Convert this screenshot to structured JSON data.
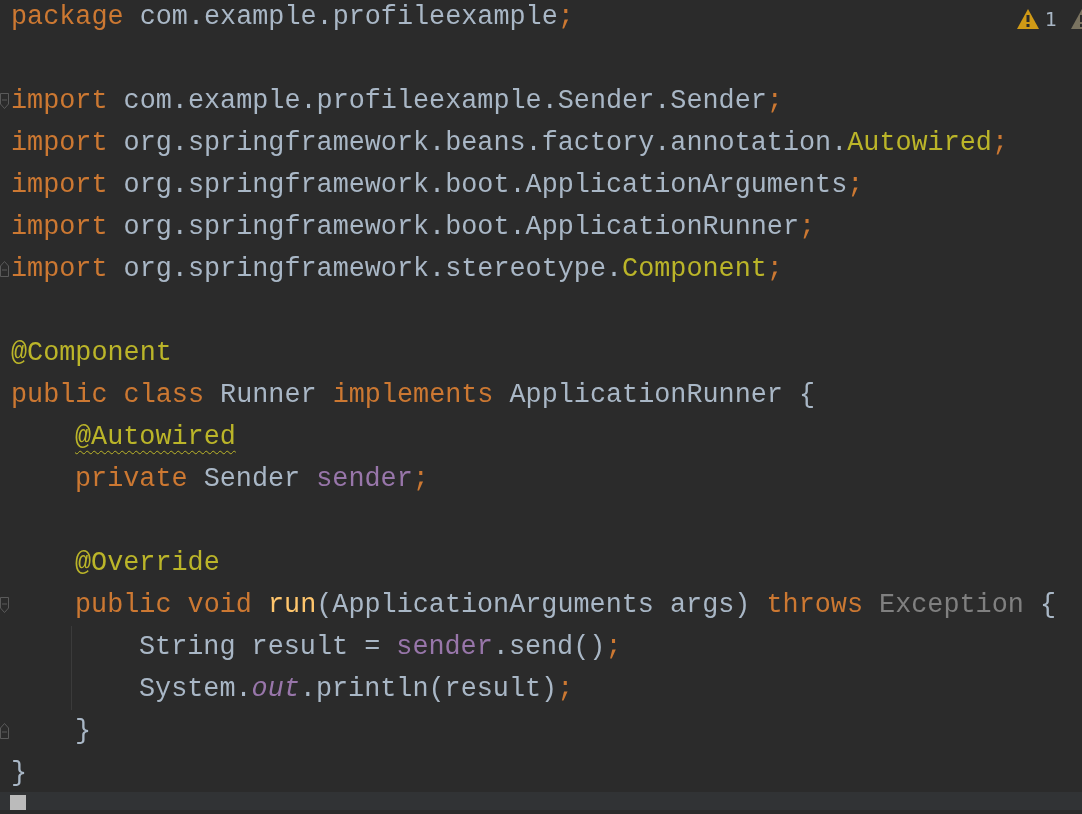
{
  "warnings": {
    "count": "1"
  },
  "lines": [
    {
      "tokens": [
        {
          "kind": "keyword",
          "text": "package "
        },
        {
          "kind": "plain",
          "text": "com.example.profileexample"
        },
        {
          "kind": "keyword",
          "text": ";"
        }
      ]
    },
    {
      "blank_before": true,
      "fold_start": true,
      "tokens": [
        {
          "kind": "keyword",
          "text": "import "
        },
        {
          "kind": "plain",
          "text": "com.example.profileexample.Sender.Sender"
        },
        {
          "kind": "keyword",
          "text": ";"
        }
      ]
    },
    {
      "tokens": [
        {
          "kind": "keyword",
          "text": "import "
        },
        {
          "kind": "plain",
          "text": "org.springframework.beans.factory.annotation."
        },
        {
          "kind": "annotation",
          "text": "Autowired"
        },
        {
          "kind": "keyword",
          "text": ";"
        }
      ]
    },
    {
      "tokens": [
        {
          "kind": "keyword",
          "text": "import "
        },
        {
          "kind": "plain",
          "text": "org.springframework.boot.ApplicationArguments"
        },
        {
          "kind": "keyword",
          "text": ";"
        }
      ]
    },
    {
      "tokens": [
        {
          "kind": "keyword",
          "text": "import "
        },
        {
          "kind": "plain",
          "text": "org.springframework.boot.ApplicationRunner"
        },
        {
          "kind": "keyword",
          "text": ";"
        }
      ]
    },
    {
      "fold_end": true,
      "tokens": [
        {
          "kind": "keyword",
          "text": "import "
        },
        {
          "kind": "plain",
          "text": "org.springframework.stereotype."
        },
        {
          "kind": "annotation",
          "text": "Component"
        },
        {
          "kind": "keyword",
          "text": ";"
        }
      ]
    },
    {
      "blank_before": true,
      "tokens": [
        {
          "kind": "annotation",
          "text": "@Component"
        }
      ]
    },
    {
      "tokens": [
        {
          "kind": "keyword",
          "text": "public class "
        },
        {
          "kind": "plain",
          "text": "Runner "
        },
        {
          "kind": "keyword",
          "text": "implements "
        },
        {
          "kind": "plain",
          "text": "ApplicationRunner {"
        }
      ],
      "children": [
        {
          "tokens": [
            {
              "kind": "annotation_warn",
              "text": "@Autowired"
            }
          ]
        },
        {
          "tokens": [
            {
              "kind": "keyword",
              "text": "private "
            },
            {
              "kind": "plain",
              "text": "Sender "
            },
            {
              "kind": "field",
              "text": "sender"
            },
            {
              "kind": "keyword",
              "text": ";"
            }
          ]
        },
        {
          "blank_before": true,
          "tokens": [
            {
              "kind": "annotation",
              "text": "@Override"
            }
          ]
        },
        {
          "fold_start": true,
          "tokens": [
            {
              "kind": "keyword",
              "text": "public void "
            },
            {
              "kind": "method",
              "text": "run"
            },
            {
              "kind": "plain",
              "text": "(ApplicationArguments args) "
            },
            {
              "kind": "keyword",
              "text": "throws "
            },
            {
              "kind": "dim",
              "text": "Exception"
            },
            {
              "kind": "plain",
              "text": " {"
            }
          ],
          "children": [
            {
              "guide": true,
              "tokens": [
                {
                  "kind": "plain",
                  "text": "String result = "
                },
                {
                  "kind": "field",
                  "text": "sender"
                },
                {
                  "kind": "plain",
                  "text": ".send()"
                },
                {
                  "kind": "keyword",
                  "text": ";"
                }
              ]
            },
            {
              "guide": true,
              "tokens": [
                {
                  "kind": "plain",
                  "text": "System."
                },
                {
                  "kind": "static",
                  "text": "out"
                },
                {
                  "kind": "plain",
                  "text": ".println(result)"
                },
                {
                  "kind": "keyword",
                  "text": ";"
                }
              ]
            }
          ]
        },
        {
          "fold_end": true,
          "tokens": [
            {
              "kind": "plain",
              "text": "}"
            }
          ]
        }
      ]
    },
    {
      "tokens": [
        {
          "kind": "plain",
          "text": "}"
        }
      ]
    }
  ]
}
